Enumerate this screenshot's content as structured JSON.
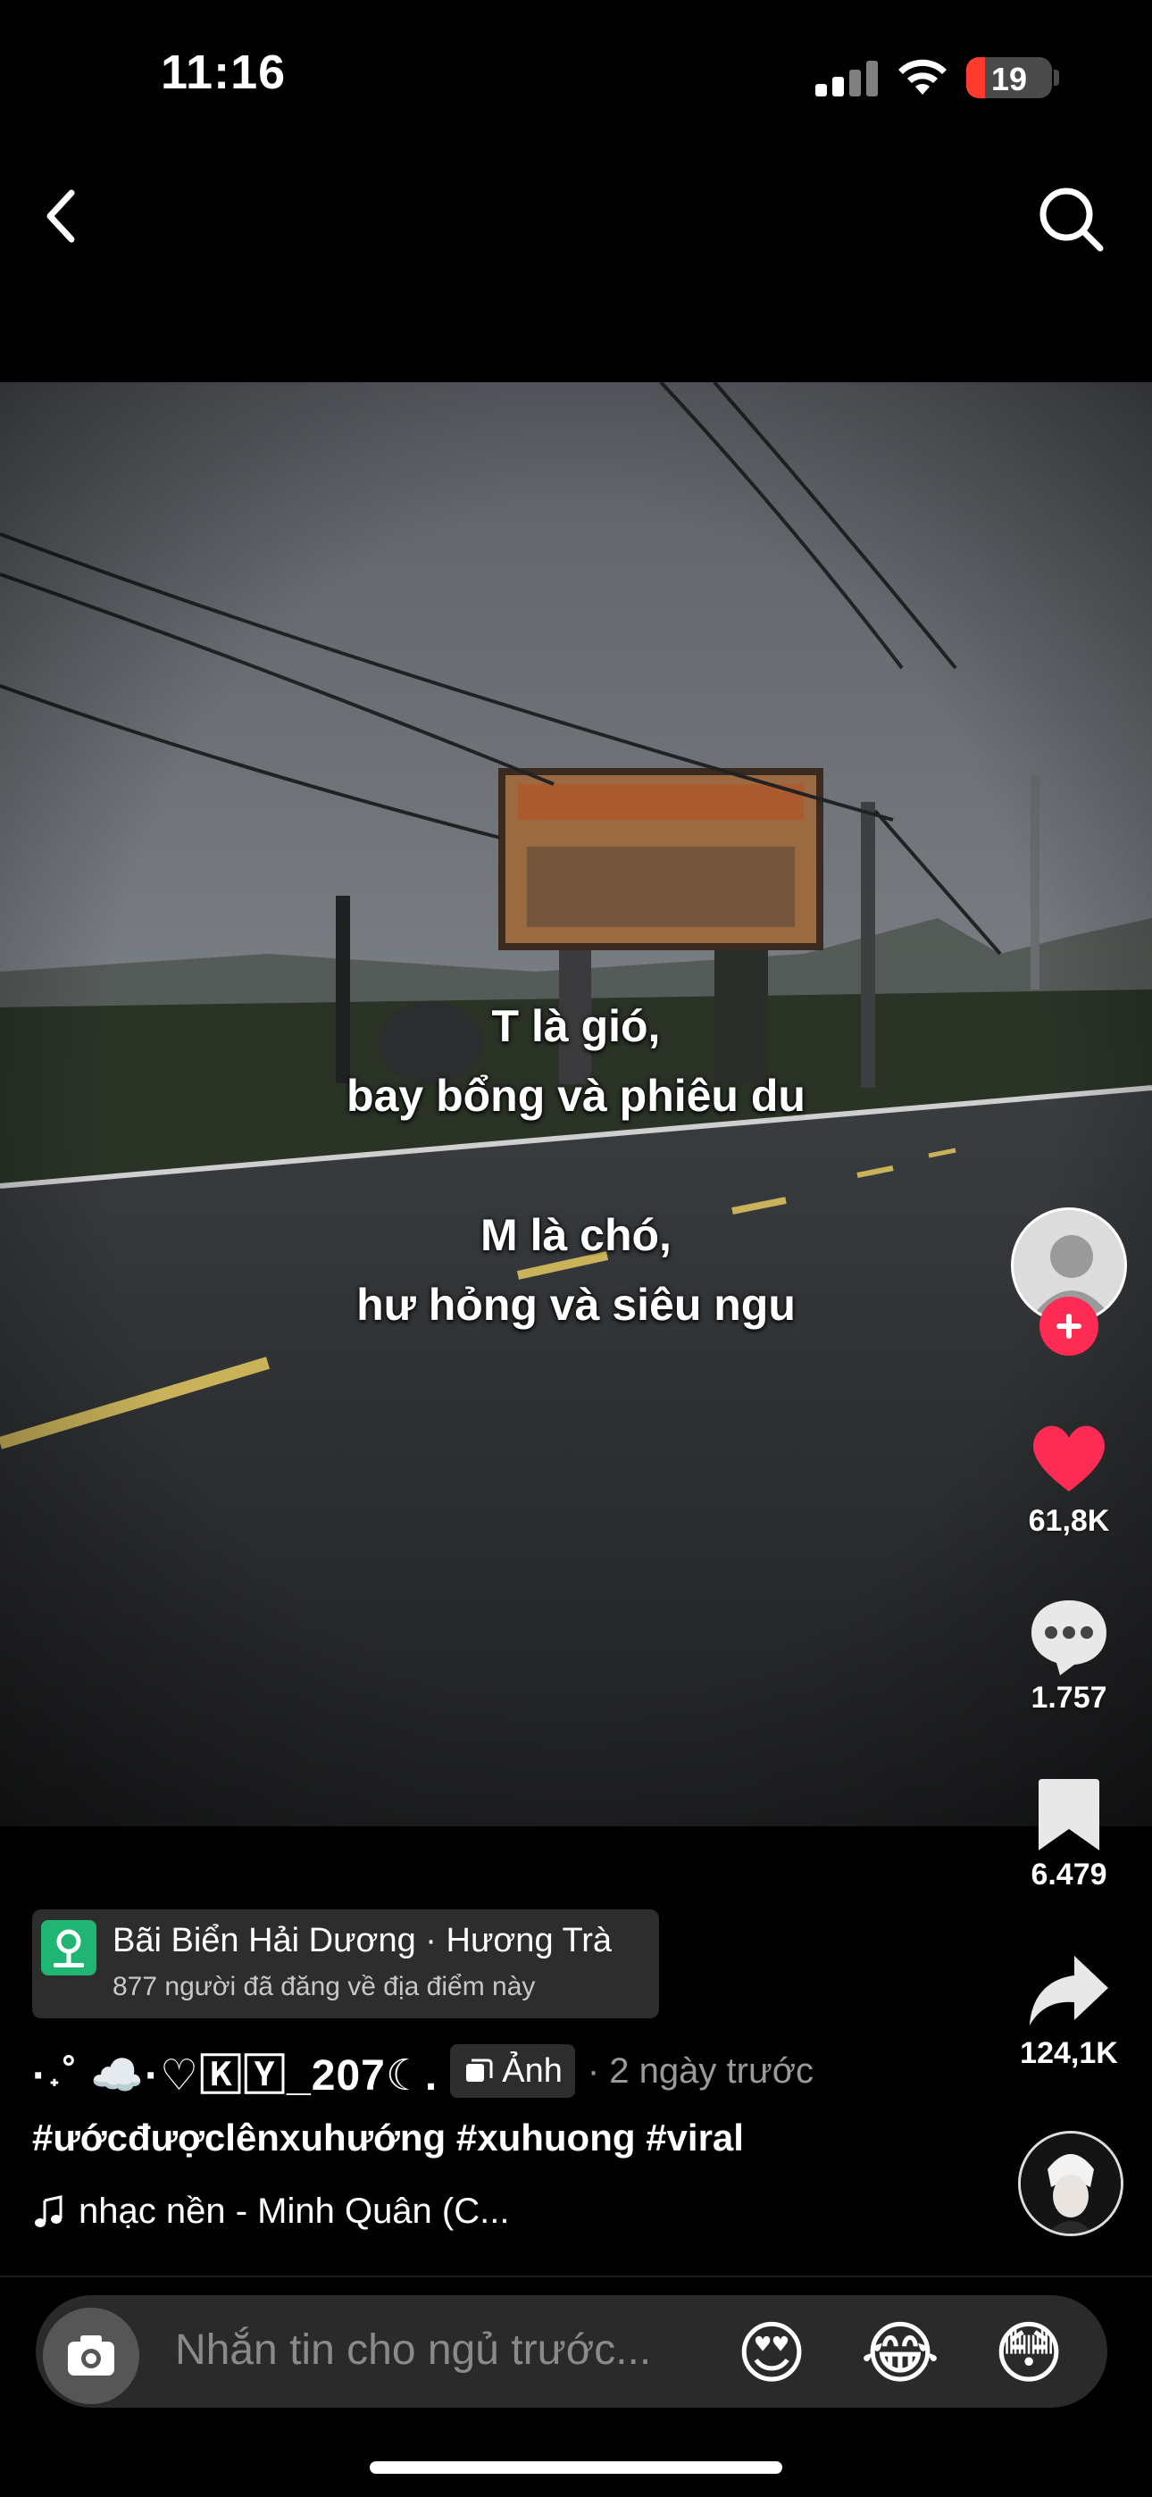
{
  "status_bar": {
    "time": "11:16",
    "battery": "19"
  },
  "post": {
    "overlay_lines": [
      "T là gió,",
      "bay bổng và phiêu du",
      "M là chó,",
      "hư hỏng và siêu ngu"
    ]
  },
  "actions": {
    "likes": "61,8K",
    "comments": "1.757",
    "saves": "6.479",
    "shares": "124,1K"
  },
  "location": {
    "title": "Bãi Biển Hải Dương · Hương Trà",
    "subtitle": "877 người đã đăng về địa điểm này"
  },
  "author": {
    "username": "·˖˚ ☁️·♡🄺🅈_207☾.",
    "badge": "Ảnh",
    "time_ago": "· 2 ngày trước"
  },
  "caption": {
    "hashtags": "#ướcđượclênxuhướng #xuhuong #viral"
  },
  "music": {
    "label": "nhạc nền - Minh Quân (C..."
  },
  "comment_bar": {
    "placeholder": "Nhắn tin cho ngủ trước...",
    "emojis": [
      "😍",
      "😂",
      "😳"
    ]
  },
  "colors": {
    "accent": "#fe2c55",
    "location_icon": "#20b573"
  }
}
